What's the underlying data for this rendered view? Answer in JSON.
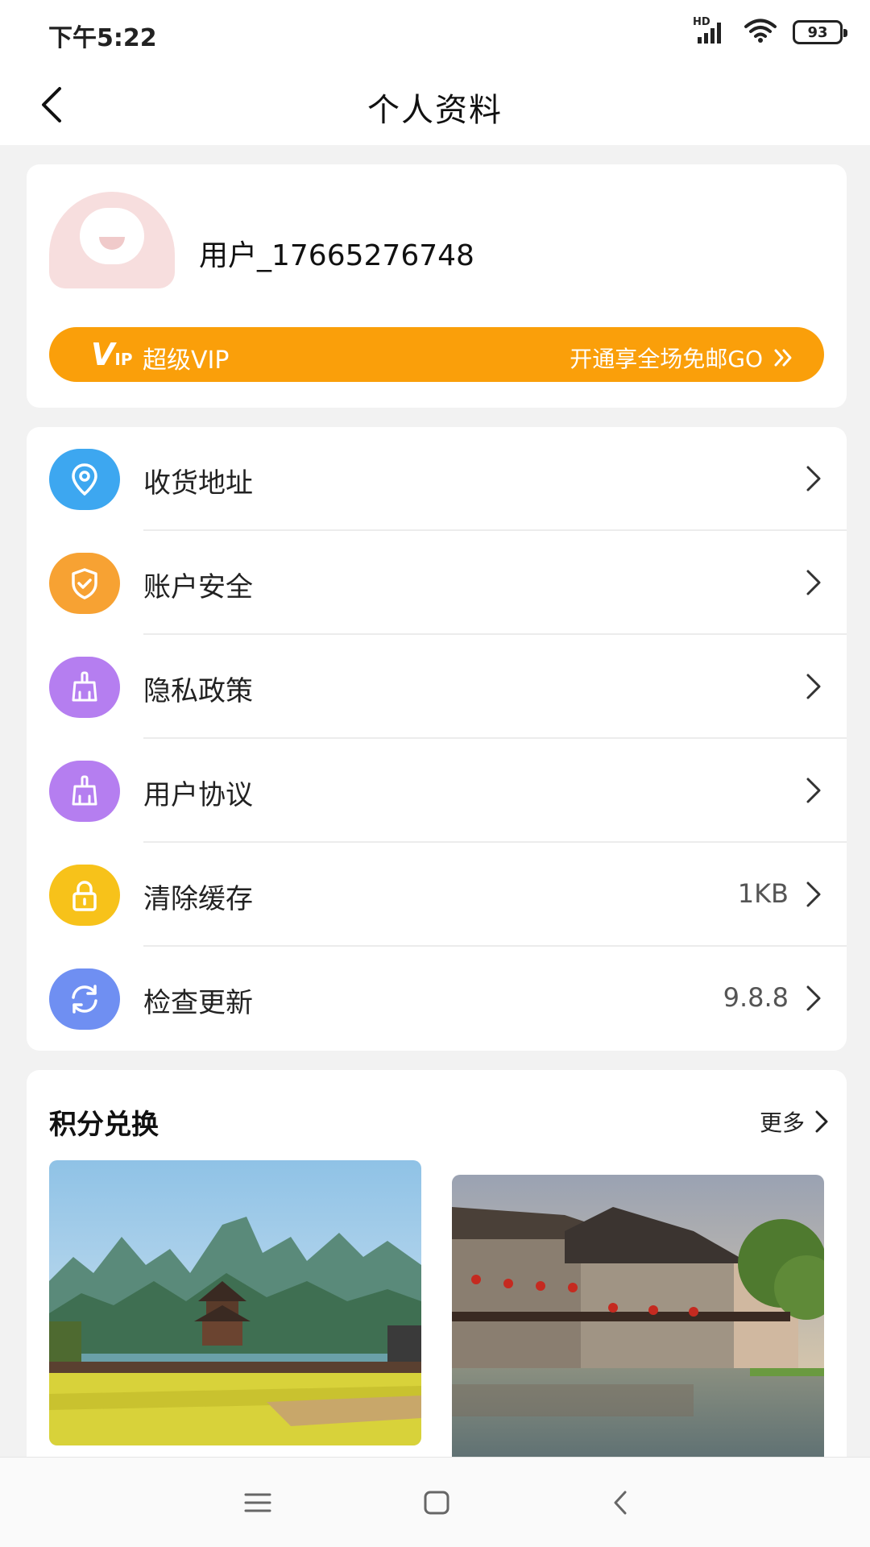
{
  "status_bar": {
    "time": "下午5:22",
    "network_label": "HD",
    "battery": "93"
  },
  "header": {
    "title": "个人资料"
  },
  "profile": {
    "username": "用户_17665276748",
    "vip": {
      "logo_main": "V",
      "logo_sub": "IP",
      "title": "超级VIP",
      "promo": "开通享全场免邮GO"
    }
  },
  "menu": {
    "items": [
      {
        "label": "收货地址",
        "value": "",
        "icon": "location-pin-icon",
        "color": "#3da7f0"
      },
      {
        "label": "账户安全",
        "value": "",
        "icon": "shield-check-icon",
        "color": "#f7a233"
      },
      {
        "label": "隐私政策",
        "value": "",
        "icon": "broom-icon",
        "color": "#b57ef0"
      },
      {
        "label": "用户协议",
        "value": "",
        "icon": "broom-icon",
        "color": "#b57ef0"
      },
      {
        "label": "清除缓存",
        "value": "1KB",
        "icon": "lock-icon",
        "color": "#f7c21a"
      },
      {
        "label": "检查更新",
        "value": "9.8.8",
        "icon": "refresh-icon",
        "color": "#6f8ff2"
      }
    ]
  },
  "exchange": {
    "title": "积分兑换",
    "more": "更多"
  },
  "colors": {
    "vip_orange": "#fa9f0a",
    "background": "#f2f2f2"
  }
}
